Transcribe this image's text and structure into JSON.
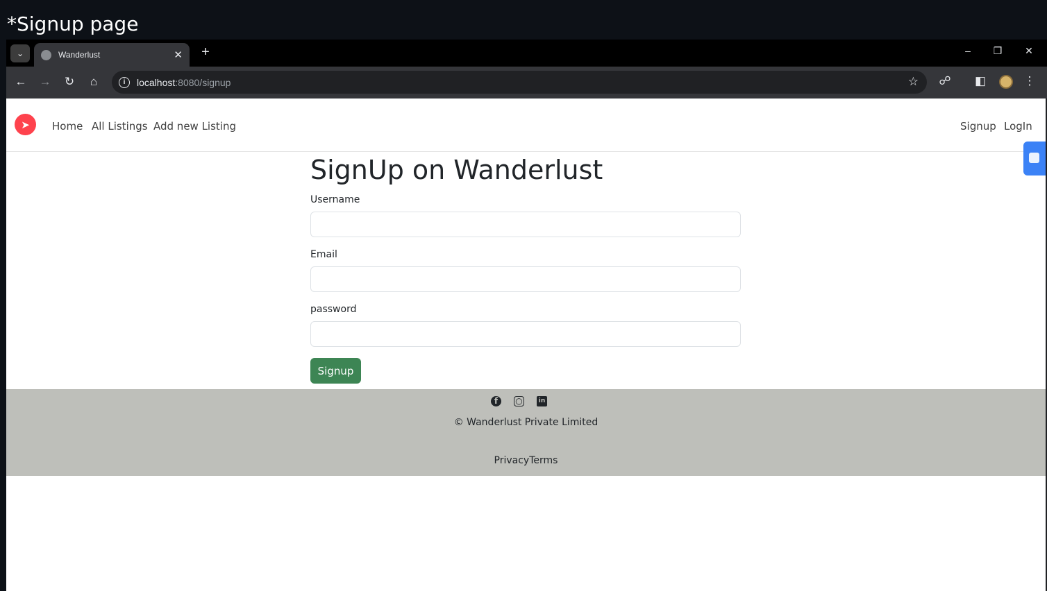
{
  "caption": "*Signup page",
  "browser": {
    "tab_title": "Wanderlust",
    "url_host": "localhost",
    "url_path": ":8080/signup"
  },
  "navbar": {
    "links": [
      "Home",
      "All Listings",
      "Add new Listing"
    ],
    "right_links": [
      "Signup",
      "LogIn"
    ],
    "brand_color": "#fe424d"
  },
  "form": {
    "heading": "SignUp on Wanderlust",
    "fields": [
      {
        "label": "Username",
        "value": ""
      },
      {
        "label": "Email",
        "value": ""
      },
      {
        "label": "password",
        "value": ""
      }
    ],
    "submit_label": "Signup",
    "submit_color": "#3d8554"
  },
  "footer": {
    "socials": [
      "facebook-icon",
      "instagram-icon",
      "linkedin-icon"
    ],
    "copyright": "© Wanderlust Private Limited",
    "policy": "PrivacyTerms",
    "background": "#bebfba"
  }
}
